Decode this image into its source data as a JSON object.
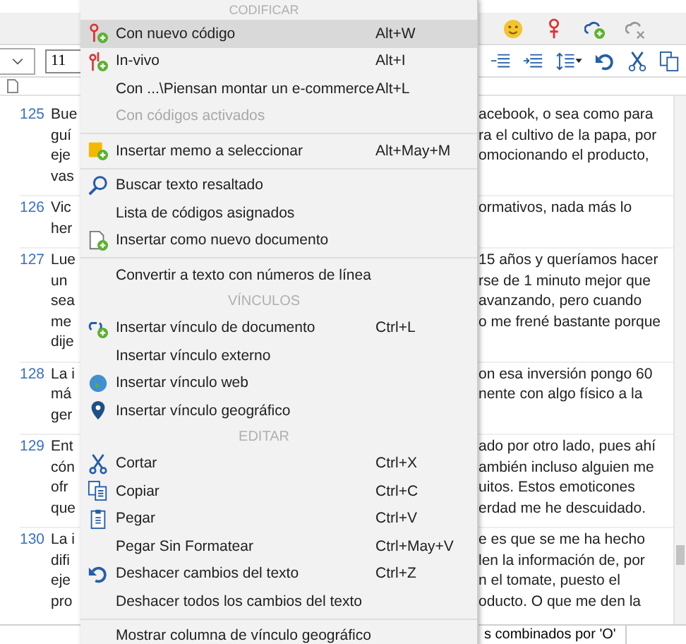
{
  "font_size_field": {
    "value": "11"
  },
  "document": {
    "paragraphs": [
      {
        "number": "125",
        "lines": [
          {
            "start": "Bue",
            "end": "acebook, o sea como para"
          },
          {
            "start": "guí",
            "end": "ra el cultivo de la papa, por"
          },
          {
            "start": "eje",
            "end": "omocionando el producto,"
          },
          {
            "start": "vas"
          }
        ]
      },
      {
        "number": "126",
        "lines": [
          {
            "start": "Vic",
            "end": "ormativos, nada más lo"
          },
          {
            "start": "her"
          }
        ]
      },
      {
        "number": "127",
        "lines": [
          {
            "start": "Lue",
            "end": "15 años y queríamos hacer"
          },
          {
            "start": "un",
            "end": "rse de 1 minuto mejor que"
          },
          {
            "start": "sea",
            "end": "avanzando, pero cuando"
          },
          {
            "start": "me",
            "end": "o me frené bastante porque"
          },
          {
            "start": "dije"
          }
        ]
      },
      {
        "number": "128",
        "lines": [
          {
            "start": "La i",
            "end": "on esa inversión pongo 60"
          },
          {
            "start": "má",
            "end": "nente con algo físico a la"
          },
          {
            "start": "ger"
          }
        ]
      },
      {
        "number": "129",
        "lines": [
          {
            "start": "Ent",
            "end": "ado por otro lado, pues ahí"
          },
          {
            "start": "cón",
            "end": "ambién incluso alguien me"
          },
          {
            "start": "ofr",
            "end": "uitos. Estos emoticones"
          },
          {
            "start": "que",
            "end": "erdad me he descuidado."
          }
        ]
      },
      {
        "number": "130",
        "lines": [
          {
            "start": "La i",
            "end": "e es que se me ha hecho"
          },
          {
            "start": "difi",
            "end": "len la información de, por"
          },
          {
            "start": "eje",
            "end": "n el tomate, puesto el"
          },
          {
            "start": "pro",
            "end": "oducto. O que me den la"
          }
        ]
      }
    ]
  },
  "status_field": {
    "value": "s combinados por 'O'"
  },
  "context_menu": [
    {
      "kind": "header",
      "label": "CODIFICAR"
    },
    {
      "kind": "item",
      "label": "Con nuevo código",
      "shortcut": "Alt+W",
      "selected": true,
      "disabled": false
    },
    {
      "kind": "item",
      "label": "In-vivo",
      "shortcut": "Alt+I",
      "selected": false,
      "disabled": false
    },
    {
      "kind": "item",
      "label": "Con ...\\Piensan montar un e-commerce",
      "shortcut": "Alt+L",
      "selected": false,
      "disabled": false
    },
    {
      "kind": "item",
      "label": "Con códigos activados",
      "selected": false,
      "disabled": true
    },
    {
      "kind": "separator"
    },
    {
      "kind": "item",
      "label": "Insertar memo a seleccionar",
      "shortcut": "Alt+May+M",
      "selected": false,
      "disabled": false
    },
    {
      "kind": "separator"
    },
    {
      "kind": "item",
      "label": "Buscar texto resaltado",
      "selected": false,
      "disabled": false
    },
    {
      "kind": "item",
      "label": "Lista de códigos asignados",
      "selected": false,
      "disabled": false
    },
    {
      "kind": "item",
      "label": "Insertar como nuevo documento",
      "selected": false,
      "disabled": false
    },
    {
      "kind": "separator"
    },
    {
      "kind": "item",
      "label": "Convertir a texto con números de línea",
      "selected": false,
      "disabled": false
    },
    {
      "kind": "header",
      "label": "VÍNCULOS"
    },
    {
      "kind": "item",
      "label": "Insertar vínculo de documento",
      "shortcut": "Ctrl+L",
      "selected": false,
      "disabled": false
    },
    {
      "kind": "item",
      "label": "Insertar vínculo externo",
      "selected": false,
      "disabled": false
    },
    {
      "kind": "item",
      "label": "Insertar vínculo web",
      "selected": false,
      "disabled": false
    },
    {
      "kind": "item",
      "label": "Insertar vínculo geográfico",
      "selected": false,
      "disabled": false
    },
    {
      "kind": "header",
      "label": "EDITAR"
    },
    {
      "kind": "item",
      "label": "Cortar",
      "shortcut": "Ctrl+X",
      "selected": false,
      "disabled": false
    },
    {
      "kind": "item",
      "label": "Copiar",
      "shortcut": "Ctrl+C",
      "selected": false,
      "disabled": false
    },
    {
      "kind": "item",
      "label": "Pegar",
      "shortcut": "Ctrl+V",
      "selected": false,
      "disabled": false
    },
    {
      "kind": "item",
      "label": "Pegar Sin Formatear",
      "shortcut": "Ctrl+May+V",
      "selected": false,
      "disabled": false
    },
    {
      "kind": "item",
      "label": "Deshacer cambios del texto",
      "shortcut": "Ctrl+Z",
      "selected": false,
      "disabled": false
    },
    {
      "kind": "item",
      "label": "Deshacer todos los cambios del texto",
      "selected": false,
      "disabled": false
    },
    {
      "kind": "separator"
    },
    {
      "kind": "item",
      "label": "Mostrar columna de vínculo geográfico",
      "selected": false,
      "disabled": false
    }
  ]
}
